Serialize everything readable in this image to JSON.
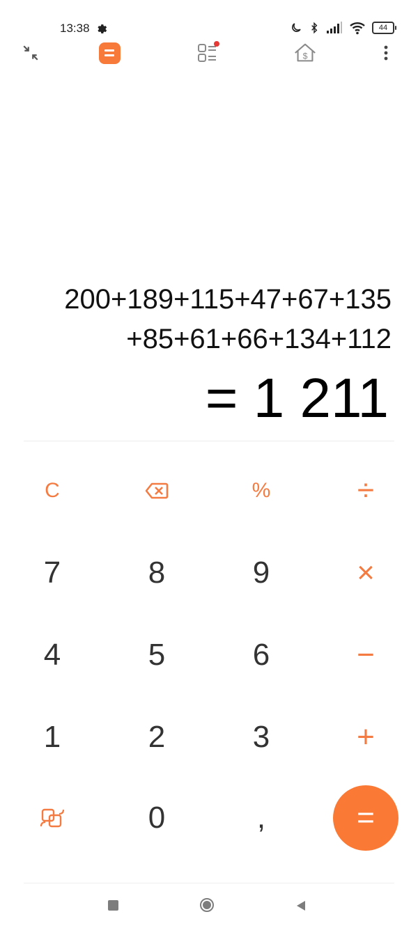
{
  "status_bar": {
    "time": "13:38",
    "battery": "44",
    "icons": [
      "settings-gear-icon",
      "moon-icon",
      "bluetooth-icon",
      "signal-icon",
      "wifi-icon",
      "battery-icon"
    ]
  },
  "toolbar": {
    "icons": [
      "collapse-icon",
      "calculator-tab-icon",
      "converter-tab-icon",
      "finance-tab-icon",
      "more-options-icon"
    ],
    "accent": "#f77a3a",
    "badge_color": "#e53935"
  },
  "display": {
    "expression_line1": "200+189+115+47+67+135",
    "expression_line2": "+85+61+66+134+112",
    "result": "= 1 211"
  },
  "keypad": {
    "row1": [
      "C",
      "backspace",
      "%",
      "÷"
    ],
    "row2": [
      "7",
      "8",
      "9",
      "×"
    ],
    "row3": [
      "4",
      "5",
      "6",
      "−"
    ],
    "row4": [
      "1",
      "2",
      "3",
      "+"
    ],
    "row5": [
      "mode",
      "0",
      ",",
      "="
    ],
    "accent_color": "#f47c42",
    "equals_bg": "#fa7a35"
  },
  "nav": {
    "icons": [
      "recents-square-icon",
      "home-circle-icon",
      "back-triangle-icon"
    ]
  }
}
